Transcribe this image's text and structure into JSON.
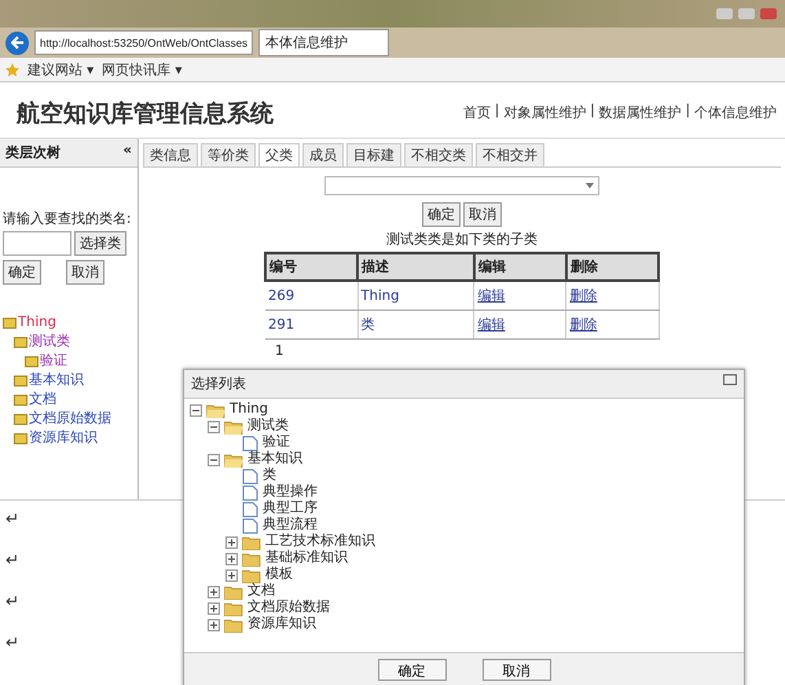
{
  "browser": {
    "address": "http://localhost:53250/OntWeb/OntClasses",
    "tab_title": "本体信息维护",
    "favorites": [
      "建议网站 ▾",
      "网页快讯库 ▾"
    ]
  },
  "header": {
    "title": "航空知识库管理信息系统",
    "nav": [
      "首页",
      "对象属性维护",
      "数据属性维护",
      "个体信息维护"
    ],
    "separator": "|"
  },
  "sidebar": {
    "title": "类层次树",
    "collapse": "«",
    "search_label": "请输入要查找的类名:",
    "select_button": "选择类",
    "buttons": [
      "确定",
      "取消"
    ],
    "tree": [
      {
        "label": "Thing",
        "color": "#e0284a",
        "children": [
          {
            "label": "测试类",
            "color": "#9b2bb3",
            "children": [
              {
                "label": "验证",
                "color": "#9b2bb3"
              }
            ]
          },
          {
            "label": "基本知识",
            "color": "#2b45c0"
          },
          {
            "label": "文档",
            "color": "#2b45c0"
          },
          {
            "label": "文档原始数据",
            "color": "#2b45c0"
          },
          {
            "label": "资源库知识",
            "color": "#2b45c0"
          }
        ]
      }
    ]
  },
  "tabs": [
    {
      "label": "类信息",
      "selected": false
    },
    {
      "label": "等价类",
      "selected": false
    },
    {
      "label": "父类",
      "selected": true
    },
    {
      "label": "成员",
      "selected": false
    },
    {
      "label": "目标建",
      "selected": false
    },
    {
      "label": "不相交类",
      "selected": false
    },
    {
      "label": "不相交并",
      "selected": false
    }
  ],
  "parent_panel": {
    "buttons": [
      "确定",
      "取消"
    ],
    "caption": "测试类类是如下类的子类",
    "columns": [
      "编号",
      "描述",
      "编辑",
      "删除"
    ],
    "rows": [
      [
        "269",
        "Thing",
        "编辑",
        "删除"
      ],
      [
        "291",
        "类",
        "编辑",
        "删除"
      ]
    ],
    "pager": "1"
  },
  "dialog": {
    "title": "选择列表",
    "buttons": [
      "确定",
      "取消"
    ],
    "tree": [
      {
        "label": "Thing",
        "kind": "folder",
        "expanded": true,
        "children": [
          {
            "label": "测试类",
            "kind": "folder",
            "expanded": true,
            "children": [
              {
                "label": "验证",
                "kind": "file"
              }
            ]
          },
          {
            "label": "基本知识",
            "kind": "folder",
            "expanded": true,
            "children": [
              {
                "label": "类",
                "kind": "file"
              },
              {
                "label": "典型操作",
                "kind": "file"
              },
              {
                "label": "典型工序",
                "kind": "file"
              },
              {
                "label": "典型流程",
                "kind": "file"
              },
              {
                "label": "工艺技术标准知识",
                "kind": "folder",
                "expanded": false
              },
              {
                "label": "基础标准知识",
                "kind": "folder",
                "expanded": false
              },
              {
                "label": "模板",
                "kind": "folder",
                "expanded": false
              }
            ]
          },
          {
            "label": "文档",
            "kind": "folder",
            "expanded": false
          },
          {
            "label": "文档原始数据",
            "kind": "folder",
            "expanded": false
          },
          {
            "label": "资源库知识",
            "kind": "folder",
            "expanded": false
          }
        ]
      }
    ]
  },
  "paragraph_marks": [
    "↵",
    "↵",
    "↵",
    "↵"
  ]
}
